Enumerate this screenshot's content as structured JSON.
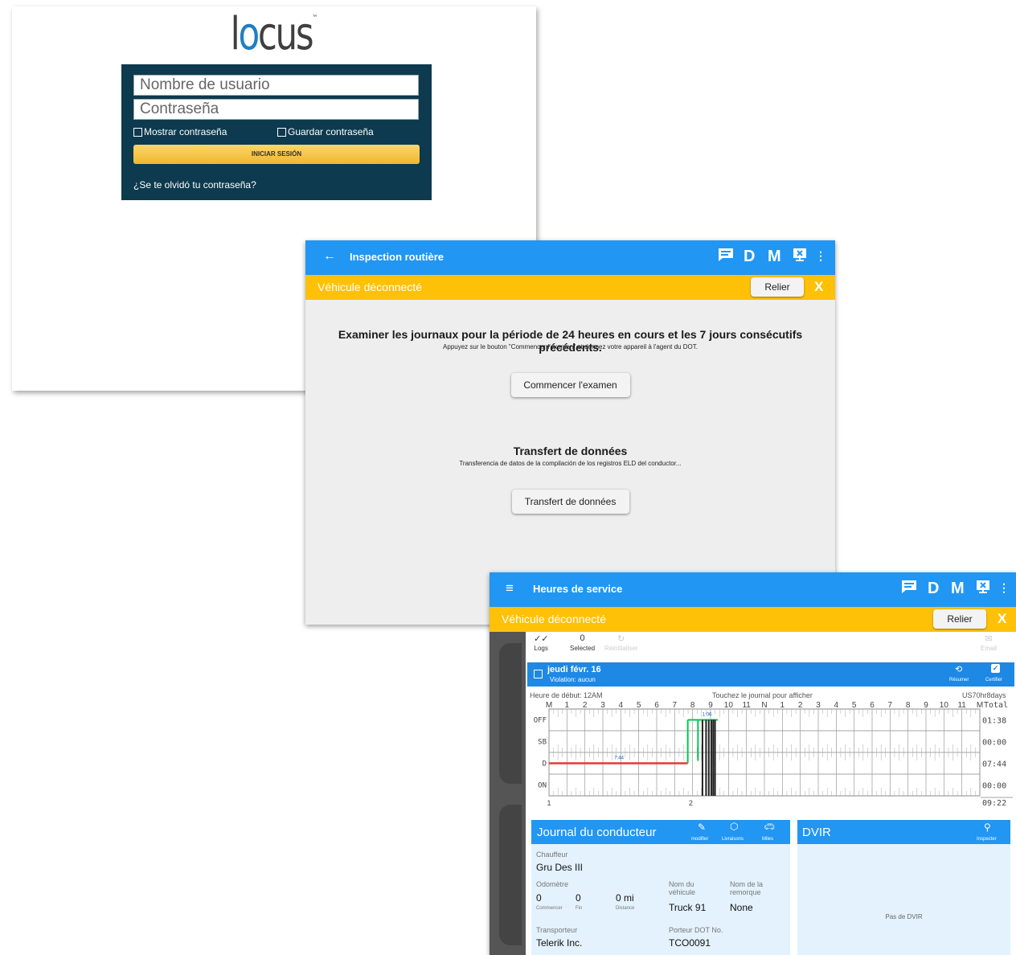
{
  "login": {
    "logo": "locus",
    "username_placeholder": "Nombre de usuario",
    "password_placeholder": "Contraseña",
    "show_password": "Mostrar contraseña",
    "save_password": "Guardar contraseña",
    "login_button": "INICIAR SESIÓN",
    "forgot": "¿Se te olvidó tu contraseña?"
  },
  "inspection": {
    "back_icon": "arrow-left-icon",
    "title": "Inspection routière",
    "toolbar": {
      "d": "D",
      "m": "M"
    },
    "banner": {
      "text": "Véhicule déconnecté",
      "relier": "Relier",
      "close": "X"
    },
    "review_heading": "Examiner les journaux pour la période de 24 heures en cours et les 7 jours consécutifs précédents.",
    "review_sub": "Appuyez sur le bouton \"Commencer l'examen\" et donnez votre appareil à l'agent du DOT.",
    "review_button": "Commencer l'examen",
    "transfer_heading": "Transfert de données",
    "transfer_sub": "Transferencia de datos de la compilación de los registros ELD del conductor...",
    "transfer_button": "Transfert de données"
  },
  "hos": {
    "menu_icon": "hamburger-icon",
    "title": "Heures de service",
    "toolbar": {
      "d": "D",
      "m": "M"
    },
    "banner": {
      "text": "Véhicule déconnecté",
      "relier": "Relier",
      "close": "X"
    },
    "tabs": {
      "logs": "Logs",
      "selected_count": "0",
      "selected": "Selected",
      "reinit": "Réinitialiser",
      "email": "Email"
    },
    "day": {
      "date": "jeudi févr. 16",
      "violation": "Violation: aucun",
      "resume": "Résumer",
      "certify": "Certifier"
    },
    "grid": {
      "start": "Heure de début: 12AM",
      "tap": "Touchez le journal pour afficher",
      "rule": "US70hr8days",
      "hours": [
        "M",
        "1",
        "2",
        "3",
        "4",
        "5",
        "6",
        "7",
        "8",
        "9",
        "10",
        "11",
        "N",
        "1",
        "2",
        "3",
        "4",
        "5",
        "6",
        "7",
        "8",
        "9",
        "10",
        "11",
        "M"
      ],
      "total_label": "Total",
      "rows": [
        "OFF",
        "SB",
        "D",
        "ON"
      ],
      "totals": [
        "01:38",
        "00:00",
        "07:44",
        "00:00"
      ],
      "grand_total": "09:22",
      "driving_label": "7:44",
      "off_label": "1:06",
      "bottom_left": "1",
      "bottom_mid": "2"
    },
    "journal": {
      "title": "Journal du conducteur",
      "modify": "modifier",
      "deliveries": "Livraisons",
      "miles": "Miles",
      "driver_label": "Chauffeur",
      "driver": "Gru Des III",
      "odometer_label": "Odomètre",
      "odo_start": "0",
      "odo_end": "0",
      "odo_dist": "0 mi",
      "odo_start_label": "Commencer",
      "odo_end_label": "Fin",
      "odo_dist_label": "Distance",
      "vehicle_label": "Nom du véhicule",
      "vehicle": "Truck 91",
      "trailer_label": "Nom de la remorque",
      "trailer": "None",
      "carrier_label": "Transporteur",
      "carrier": "Telerik Inc.",
      "dot_label": "Porteur DOT No.",
      "dot": "TCO0091"
    },
    "dvir": {
      "title": "DVIR",
      "inspect": "Inspecter",
      "empty": "Pas de DVIR"
    }
  },
  "colors": {
    "blue": "#2196f3",
    "amber": "#ffc107",
    "navy": "#0d3a4f",
    "driving": "#e53935",
    "offduty": "#00c853"
  }
}
